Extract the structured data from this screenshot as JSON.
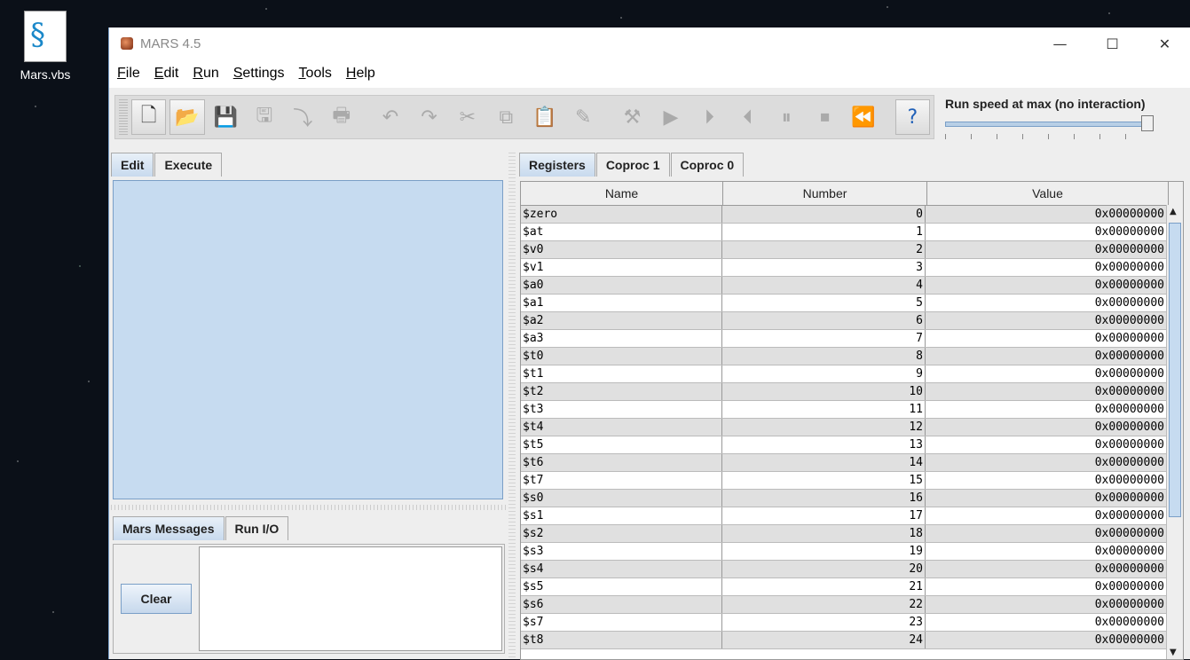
{
  "desktop": {
    "icon_label": "Mars.vbs"
  },
  "window": {
    "title": "MARS 4.5"
  },
  "menu": [
    {
      "u": "F",
      "rest": "ile"
    },
    {
      "u": "E",
      "rest": "dit"
    },
    {
      "u": "R",
      "rest": "un"
    },
    {
      "u": "S",
      "rest": "ettings"
    },
    {
      "u": "T",
      "rest": "ools"
    },
    {
      "u": "H",
      "rest": "elp"
    }
  ],
  "speed": {
    "label": "Run speed at max (no interaction)",
    "level": 1.0
  },
  "left_tabs": [
    "Edit",
    "Execute"
  ],
  "message_tabs": [
    "Mars Messages",
    "Run I/O"
  ],
  "clear_label": "Clear",
  "right_tabs": [
    "Registers",
    "Coproc 1",
    "Coproc 0"
  ],
  "table": {
    "headers": [
      "Name",
      "Number",
      "Value"
    ],
    "rows": [
      [
        "$zero",
        "0",
        "0x00000000"
      ],
      [
        "$at",
        "1",
        "0x00000000"
      ],
      [
        "$v0",
        "2",
        "0x00000000"
      ],
      [
        "$v1",
        "3",
        "0x00000000"
      ],
      [
        "$a0",
        "4",
        "0x00000000"
      ],
      [
        "$a1",
        "5",
        "0x00000000"
      ],
      [
        "$a2",
        "6",
        "0x00000000"
      ],
      [
        "$a3",
        "7",
        "0x00000000"
      ],
      [
        "$t0",
        "8",
        "0x00000000"
      ],
      [
        "$t1",
        "9",
        "0x00000000"
      ],
      [
        "$t2",
        "10",
        "0x00000000"
      ],
      [
        "$t3",
        "11",
        "0x00000000"
      ],
      [
        "$t4",
        "12",
        "0x00000000"
      ],
      [
        "$t5",
        "13",
        "0x00000000"
      ],
      [
        "$t6",
        "14",
        "0x00000000"
      ],
      [
        "$t7",
        "15",
        "0x00000000"
      ],
      [
        "$s0",
        "16",
        "0x00000000"
      ],
      [
        "$s1",
        "17",
        "0x00000000"
      ],
      [
        "$s2",
        "18",
        "0x00000000"
      ],
      [
        "$s3",
        "19",
        "0x00000000"
      ],
      [
        "$s4",
        "20",
        "0x00000000"
      ],
      [
        "$s5",
        "21",
        "0x00000000"
      ],
      [
        "$s6",
        "22",
        "0x00000000"
      ],
      [
        "$s7",
        "23",
        "0x00000000"
      ],
      [
        "$t8",
        "24",
        "0x00000000"
      ]
    ]
  },
  "toolbar_icons": [
    "new-file-icon",
    "open-file-icon",
    "save-icon",
    "save-as-icon",
    "dump-memory-icon",
    "print-icon",
    "undo-icon",
    "redo-icon",
    "cut-icon",
    "copy-icon",
    "paste-icon",
    "find-replace-icon",
    "assemble-icon",
    "run-icon",
    "step-icon",
    "backstep-icon",
    "pause-icon",
    "stop-icon",
    "reset-icon",
    "help-icon"
  ]
}
